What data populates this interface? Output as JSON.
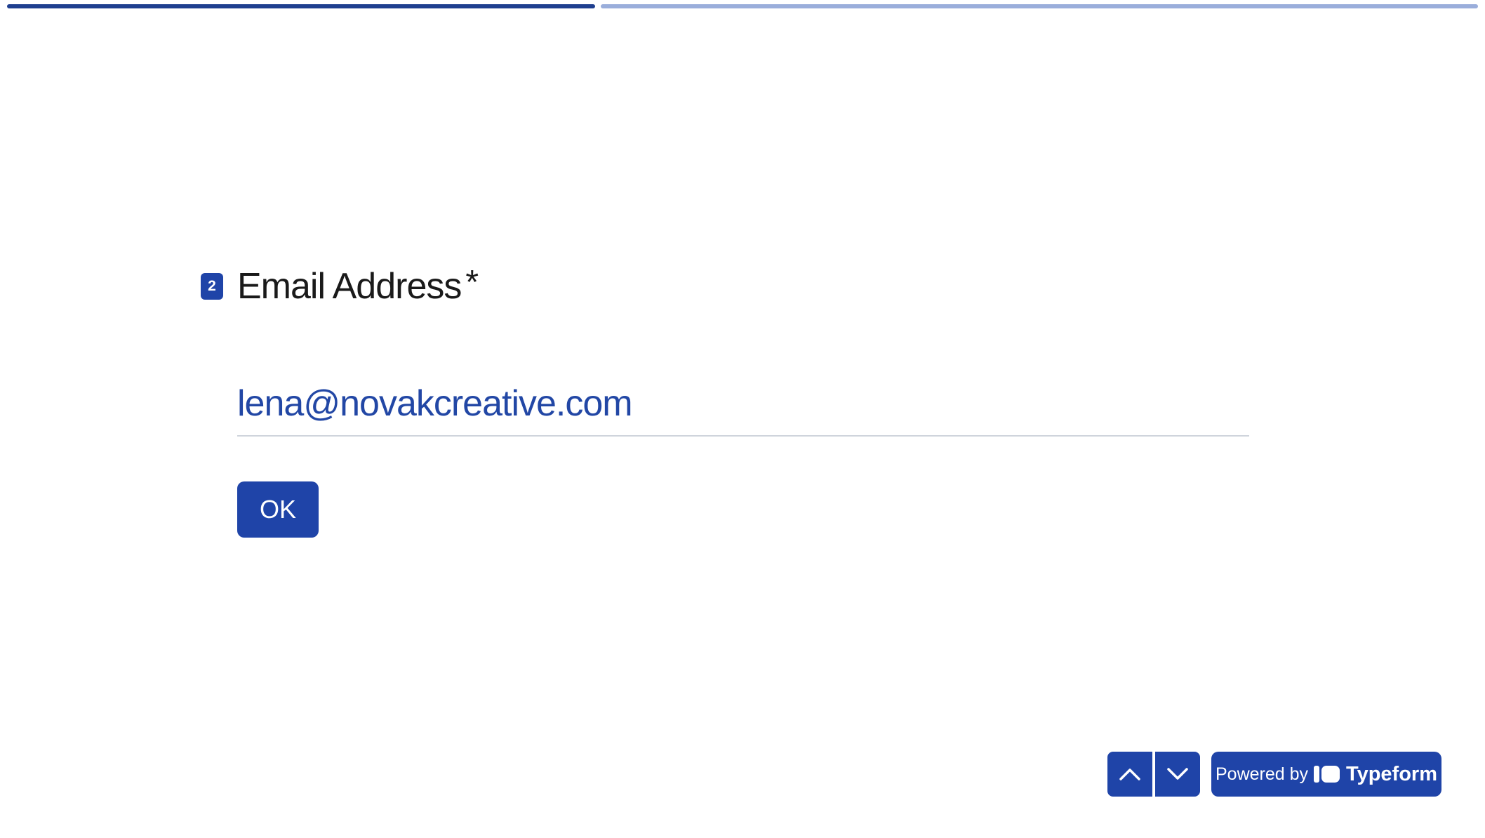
{
  "progress": {
    "completed_fraction": 0.4,
    "fill_color": "#1f3f8f",
    "track_color": "#9aaedb"
  },
  "question": {
    "number": "2",
    "title": "Email Address",
    "required_mark": "*"
  },
  "answer": {
    "value": "lena@novakcreative.com",
    "text_color": "#2247a5"
  },
  "ok_button": {
    "label": "OK"
  },
  "navigation": {
    "up_icon": "chevron-up-icon",
    "down_icon": "chevron-down-icon"
  },
  "branding": {
    "powered_by": "Powered by",
    "brand_name": "Typeform"
  },
  "colors": {
    "accent": "#1f44a8",
    "text": "#1a1a1a",
    "divider": "#cfd4dc"
  }
}
